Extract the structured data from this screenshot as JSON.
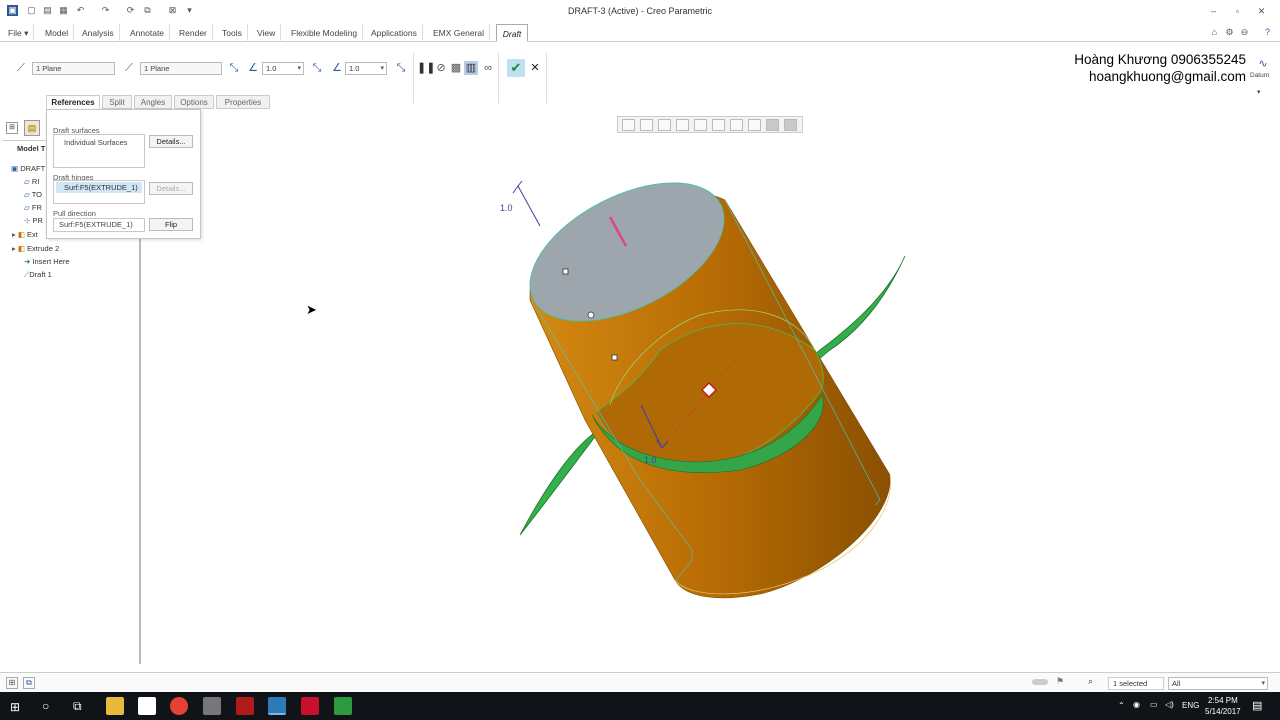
{
  "window": {
    "title": "DRAFT-3 (Active) - Creo Parametric"
  },
  "ribbon_tabs": [
    "File",
    "Model",
    "Analysis",
    "Annotate",
    "Render",
    "Tools",
    "View",
    "Flexible Modeling",
    "Applications",
    "EMX General",
    "Draft"
  ],
  "active_tab": "Draft",
  "dashboard": {
    "hinge_field_1": "1 Plane",
    "hinge_field_2": "1 Plane",
    "angle_1": "1.0",
    "angle_2": "1.0"
  },
  "credit": {
    "name_phone": "Hoàng Khương 0906355245",
    "email": "hoangkhuong@gmail.com"
  },
  "datum_label": "Datum",
  "subtabs": [
    "References",
    "Split",
    "Angles",
    "Options",
    "Properties"
  ],
  "active_subtab": "References",
  "references": {
    "draft_surfaces_label": "Draft surfaces",
    "draft_surfaces_value": "Individual Surfaces",
    "details_label": "Details...",
    "draft_hinges_label": "Draft hinges",
    "draft_hinges_value": "Surf:F5(EXTRUDE_1)",
    "details2_label": "Details...",
    "pull_direction_label": "Pull direction",
    "pull_direction_value": "Surf:F5(EXTRUDE_1)",
    "flip_label": "Flip"
  },
  "model_tree": {
    "header": "Model T",
    "items": [
      "DRAFT",
      "RI",
      "TO",
      "FR",
      "PR",
      "Ext",
      "Extrude 2",
      "Insert Here",
      "Draft 1"
    ]
  },
  "viewport": {
    "angle_label_1": "1.0",
    "angle_label_2": "1.0",
    "colors": {
      "cylinder": "#c47a0a",
      "cap": "#9ca6ae",
      "surface": "#2faa48"
    }
  },
  "status": {
    "selected": "1 selected",
    "filter": "All"
  },
  "taskbar": {
    "lang": "ENG",
    "time": "2:54 PM",
    "date": "5/14/2017"
  }
}
